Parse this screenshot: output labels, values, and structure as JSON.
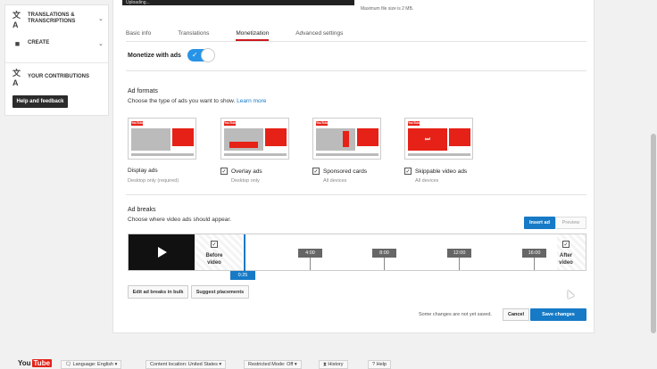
{
  "sidebar": {
    "items": [
      {
        "icon": "translate-icon",
        "label": "TRANSLATIONS & TRANSCRIPTIONS"
      },
      {
        "icon": "camera-icon",
        "label": "CREATE"
      },
      {
        "icon": "translate-icon",
        "label": "YOUR CONTRIBUTIONS"
      }
    ],
    "help_label": "Help and feedback"
  },
  "upload": {
    "status": "Uploading...",
    "max_size": "Maximum file size is 2 MB."
  },
  "tabs": [
    {
      "label": "Basic info"
    },
    {
      "label": "Translations"
    },
    {
      "label": "Monetization"
    },
    {
      "label": "Advanced settings"
    }
  ],
  "monetize": {
    "label": "Monetize with ads",
    "enabled": true
  },
  "ad_formats": {
    "title": "Ad formats",
    "subtitle": "Choose the type of ads you want to show.",
    "learn_more": "Learn more",
    "items": [
      {
        "label": "Display ads",
        "sub": "Desktop only (required)",
        "checked": false
      },
      {
        "label": "Overlay ads",
        "sub": "Desktop only",
        "checked": true
      },
      {
        "label": "Sponsored cards",
        "sub": "All devices",
        "checked": true
      },
      {
        "label": "Skippable video ads",
        "sub": "All devices",
        "checked": true
      }
    ]
  },
  "ad_breaks": {
    "title": "Ad breaks",
    "subtitle": "Choose where video ads should appear.",
    "insert_ad": "Insert ad",
    "preview": "Preview",
    "before_label": "Before video",
    "after_label": "After video",
    "markers": [
      "4:00",
      "8:00",
      "12:00",
      "16:00"
    ],
    "playhead_time": "0:25",
    "edit_bulk": "Edit ad breaks in bulk",
    "suggest": "Suggest placements"
  },
  "actions": {
    "notice": "Some changes are not yet saved.",
    "cancel": "Cancel",
    "save": "Save changes"
  },
  "footer": {
    "logo_you": "You",
    "logo_tube": "Tube",
    "language": "Language: English",
    "content_location": "Content location: United States",
    "restricted": "Restricted Mode: Off",
    "history": "History",
    "help": "Help"
  },
  "colors": {
    "accent": "#167ac6",
    "brand": "#e62117",
    "toggle": "#2793e6"
  }
}
